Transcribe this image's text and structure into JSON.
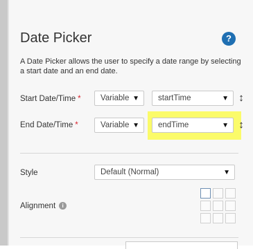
{
  "panel": {
    "title": "Date Picker",
    "help_icon_glyph": "?",
    "description": "A Date Picker allows the user to specify a date range by selecting a start date and an end date."
  },
  "start": {
    "label": "Start Date/Time",
    "required_mark": "*",
    "type_value": "Variable",
    "variable_value": "startTime"
  },
  "end": {
    "label": "End Date/Time",
    "required_mark": "*",
    "type_value": "Variable",
    "variable_value": "endTime",
    "highlight_color": "#fbfb6a"
  },
  "style": {
    "label": "Style",
    "value": "Default (Normal)"
  },
  "alignment": {
    "label": "Alignment",
    "info_glyph": "i",
    "selected_cell": "top-left"
  },
  "icons": {
    "dropdown_arrow": "▼",
    "reorder": "↕"
  },
  "colors": {
    "accent": "#1f6fb2",
    "required": "#d9232d"
  }
}
